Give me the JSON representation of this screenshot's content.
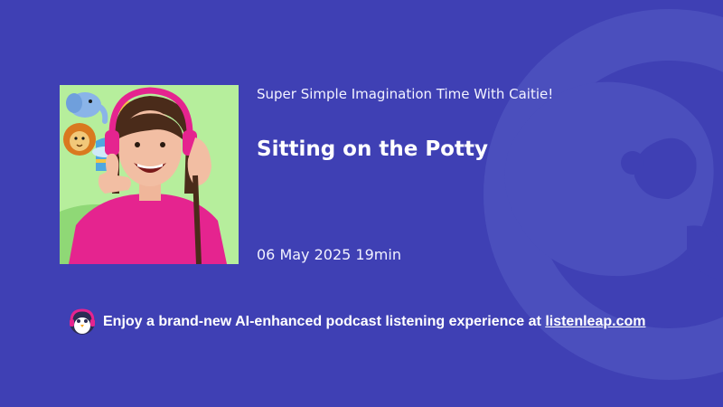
{
  "podcast": {
    "show_name": "Super Simple Imagination Time With Caitie!",
    "episode_title": "Sitting on the Potty",
    "date": "06 May 2025",
    "duration": "19min"
  },
  "promo": {
    "text": "Enjoy a brand-new AI-enhanced podcast listening experience at",
    "link_text": "listenleap.com"
  },
  "icons": {
    "background": "listenleap-logo-watermark",
    "mascot": "penguin-headphones-icon"
  },
  "colors": {
    "background": "#3f40b4",
    "watermark": "#4b4fbd",
    "text": "#ffffff",
    "cover_background": "#b6ee9c",
    "cover_shirt": "#e5248f"
  }
}
